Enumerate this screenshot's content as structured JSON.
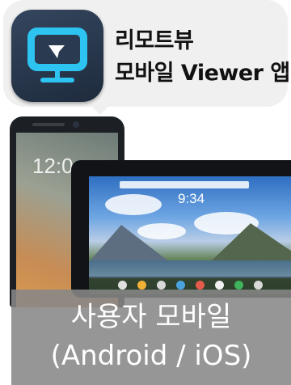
{
  "app": {
    "icon_name": "remote-monitor-icon",
    "title_line1": "리모트뷰",
    "title_line2": "모바일 Viewer 앱"
  },
  "devices": {
    "phone_clock": "12:0",
    "tablet_clock": "9:34"
  },
  "caption": {
    "line1": "사용자 모바일",
    "line2": "(Android / iOS)"
  },
  "colors": {
    "icon_blue": "#2ec4f1",
    "icon_bg": "#2a3a50",
    "caption_bg": "#888888"
  }
}
